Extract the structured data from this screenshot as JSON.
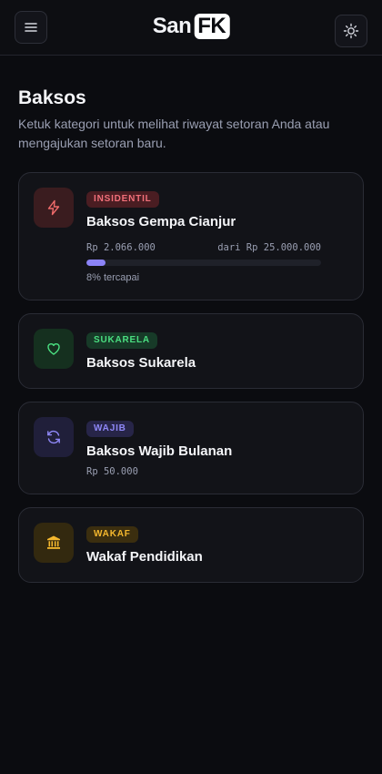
{
  "header": {
    "logo_prefix": "San",
    "logo_box": "FK"
  },
  "page": {
    "title": "Baksos",
    "subtitle": "Ketuk kategori untuk melihat riwayat setoran Anda atau mengajukan setoran baru."
  },
  "cards": [
    {
      "badge": "INSIDENTIL",
      "title": "Baksos Gempa Cianjur",
      "icon": "lightning-icon",
      "collected": "Rp 2.066.000",
      "target": "dari Rp 25.000.000",
      "progress": 0.08,
      "progress_label": "8% tercapai",
      "colors": {
        "badge_bg": "#4a1d22",
        "badge_fg": "#f2707a",
        "icon_bg": "#3a1c1f",
        "icon_fg": "#ef6b6b"
      }
    },
    {
      "badge": "SUKARELA",
      "title": "Baksos Sukarela",
      "icon": "heart-icon",
      "colors": {
        "badge_bg": "#173a28",
        "badge_fg": "#4ade80",
        "icon_bg": "#15301f",
        "icon_fg": "#4ade80"
      }
    },
    {
      "badge": "WAJIB",
      "title": "Baksos Wajib Bulanan",
      "icon": "refresh-icon",
      "amount": "Rp 50.000",
      "colors": {
        "badge_bg": "#272548",
        "badge_fg": "#8f88f8",
        "icon_bg": "#201f3a",
        "icon_fg": "#8f88f8"
      }
    },
    {
      "badge": "WAKAF",
      "title": "Wakaf Pendidikan",
      "icon": "bank-icon",
      "colors": {
        "badge_bg": "#3b2e0f",
        "badge_fg": "#f5b82e",
        "icon_bg": "#33290f",
        "icon_fg": "#f5b82e"
      }
    }
  ]
}
